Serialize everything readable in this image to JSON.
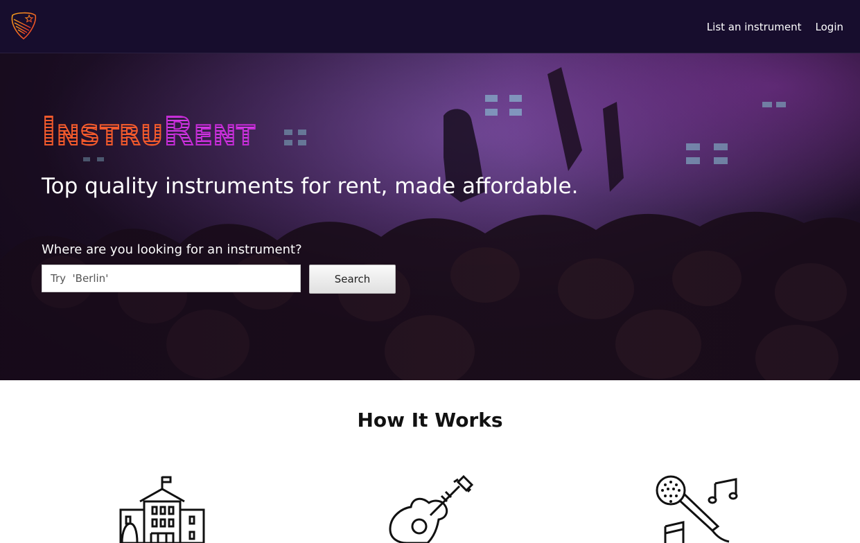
{
  "nav": {
    "logo_icon": "guitar-pick-logo",
    "links": [
      {
        "label": "List an instrument"
      },
      {
        "label": "Login"
      }
    ]
  },
  "hero": {
    "brand_part1": "Instru",
    "brand_part2": "Rent",
    "tagline": "Top quality instruments for rent, made affordable.",
    "search_label": "Where are you looking for an instrument?",
    "search_placeholder": "Try  'Berlin'",
    "search_button": "Search"
  },
  "how_it_works": {
    "title": "How It Works",
    "steps": [
      {
        "icon": "building-icon"
      },
      {
        "icon": "guitar-icon"
      },
      {
        "icon": "microphone-music-icon"
      }
    ]
  },
  "colors": {
    "nav_bg": "#170d2d",
    "brand_orange": "#f25a2c",
    "brand_magenta": "#c52ad6"
  }
}
